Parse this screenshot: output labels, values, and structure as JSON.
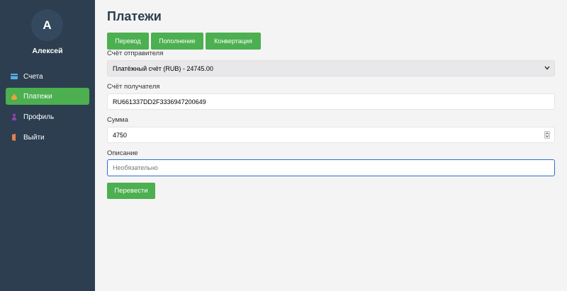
{
  "user": {
    "avatar_letter": "A",
    "name": "Алексей"
  },
  "sidebar": {
    "items": [
      {
        "label": "Счета",
        "icon": "credit-card-icon",
        "active": false
      },
      {
        "label": "Платежи",
        "icon": "money-bag-icon",
        "active": true
      },
      {
        "label": "Профиль",
        "icon": "person-icon",
        "active": false
      },
      {
        "label": "Выйти",
        "icon": "door-icon",
        "active": false
      }
    ]
  },
  "page": {
    "title": "Платежи"
  },
  "tabs": [
    {
      "label": "Перевод"
    },
    {
      "label": "Пополнение"
    },
    {
      "label": "Конвертация"
    }
  ],
  "form": {
    "sender_label": "Счёт отправителя",
    "sender_value": "Платёжный счёт (RUB) - 24745.00",
    "recipient_label": "Счёт получателя",
    "recipient_value": "RU661337DD2F3336947200649",
    "amount_label": "Сумма",
    "amount_value": "4750",
    "description_label": "Описание",
    "description_placeholder": "Необязательно",
    "submit_label": "Перевести"
  },
  "colors": {
    "sidebar_bg": "#2c3e50",
    "accent": "#4caf50",
    "focus": "#2f6fcf",
    "title": "#2c3e50"
  }
}
